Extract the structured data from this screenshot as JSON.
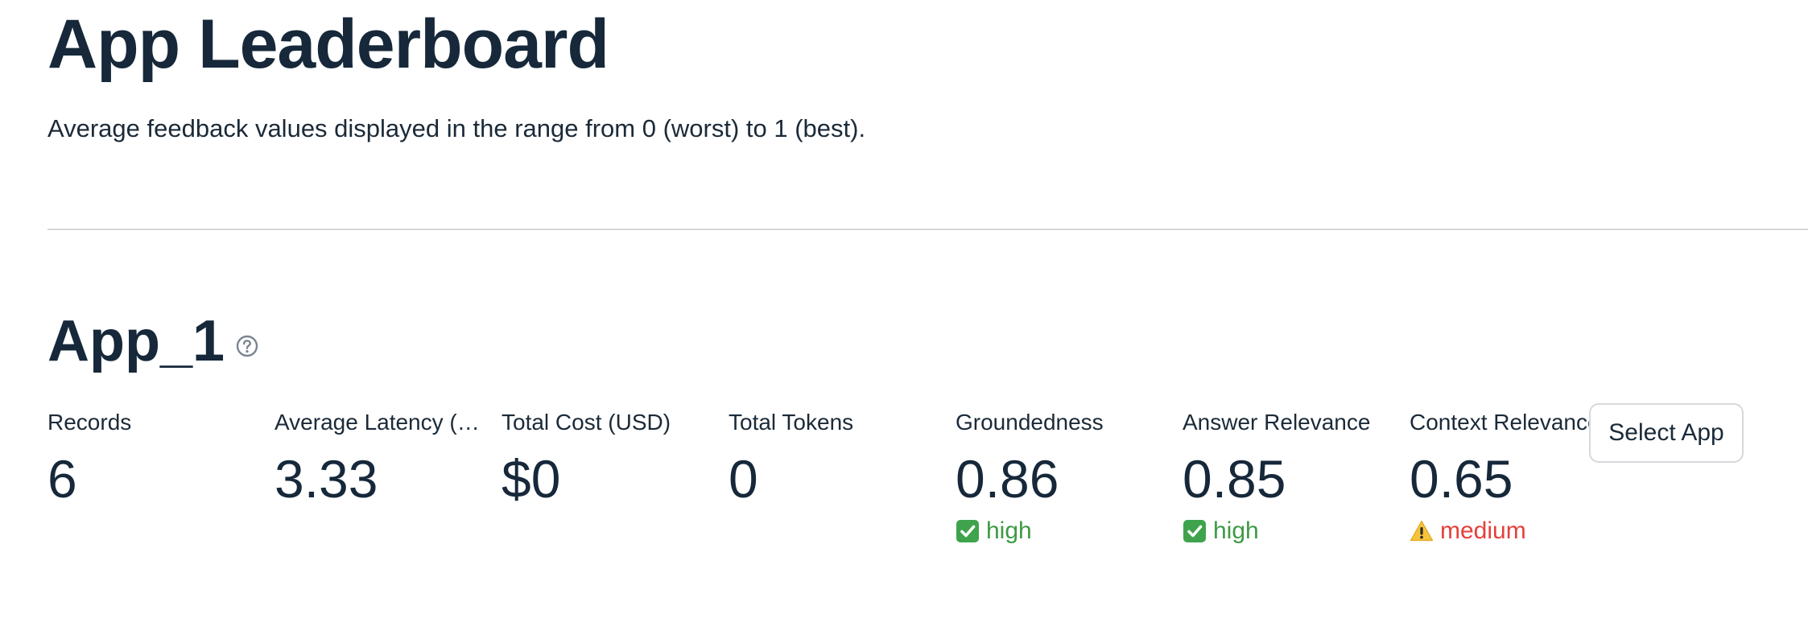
{
  "page": {
    "title": "App Leaderboard",
    "subtitle": "Average feedback values displayed in the range from 0 (worst) to 1 (best)."
  },
  "app": {
    "name": "App_1",
    "help_icon": "question-circle-icon",
    "select_button_label": "Select App",
    "metrics": [
      {
        "label": "Records",
        "value": "6"
      },
      {
        "label": "Average Latency (Seconds)",
        "value": "3.33"
      },
      {
        "label": "Total Cost (USD)",
        "value": "$0"
      },
      {
        "label": "Total Tokens",
        "value": "0"
      },
      {
        "label": "Groundedness",
        "value": "0.86",
        "delta_text": "high",
        "delta_icon": "check-mark-icon",
        "delta_color": "#3d9a43"
      },
      {
        "label": "Answer Relevance",
        "value": "0.85",
        "delta_text": "high",
        "delta_icon": "check-mark-icon",
        "delta_color": "#3d9a43"
      },
      {
        "label": "Context Relevance",
        "value": "0.65",
        "delta_text": "medium",
        "delta_icon": "warning-icon",
        "delta_color": "#e5403a"
      }
    ]
  },
  "colors": {
    "text": "#1b2a38",
    "heading": "#16283a",
    "divider": "#d6d8db",
    "positive": "#3d9a43",
    "warning": "#e5403a"
  }
}
